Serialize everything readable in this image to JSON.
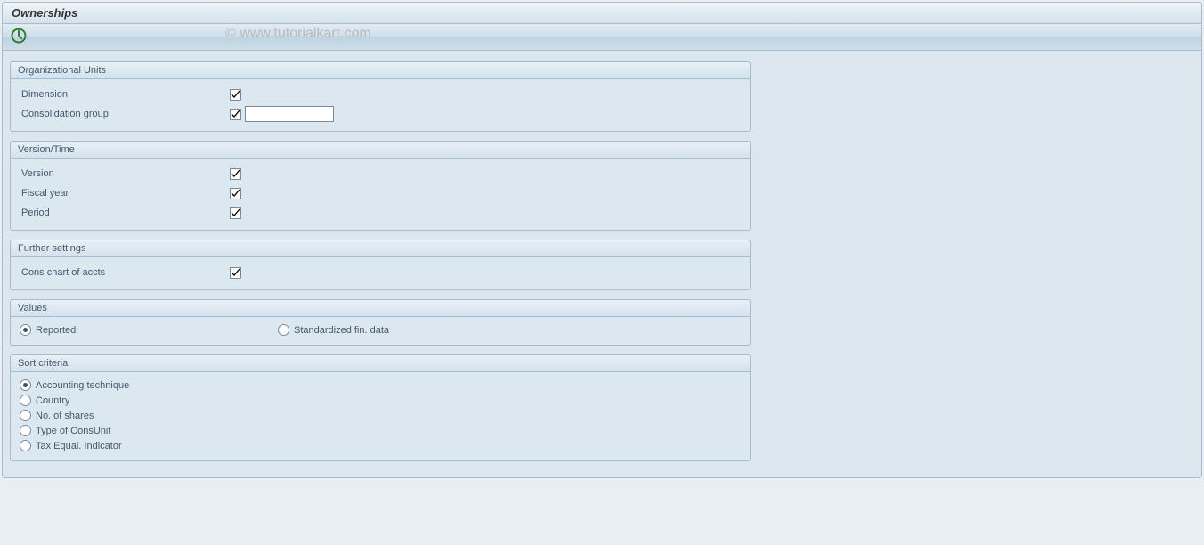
{
  "header": {
    "title": "Ownerships"
  },
  "watermark": "© www.tutorialkart.com",
  "groups": {
    "org_units": {
      "title": "Organizational Units",
      "dimension_label": "Dimension",
      "consolidation_group_label": "Consolidation group",
      "consolidation_group_value": ""
    },
    "version_time": {
      "title": "Version/Time",
      "version_label": "Version",
      "fiscal_year_label": "Fiscal year",
      "period_label": "Period"
    },
    "further_settings": {
      "title": "Further settings",
      "cons_chart_label": "Cons chart of accts"
    },
    "values": {
      "title": "Values",
      "reported_label": "Reported",
      "standardized_label": "Standardized fin. data"
    },
    "sort_criteria": {
      "title": "Sort criteria",
      "accounting_technique_label": "Accounting technique",
      "country_label": "Country",
      "no_of_shares_label": "No. of shares",
      "type_of_consunit_label": "Type of ConsUnit",
      "tax_equal_indicator_label": "Tax Equal. Indicator"
    }
  }
}
